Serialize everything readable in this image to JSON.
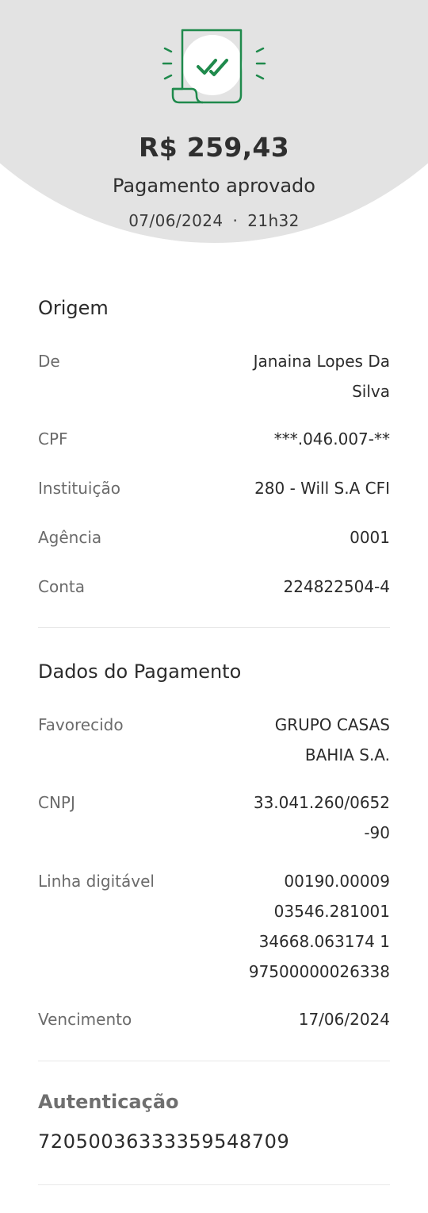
{
  "header": {
    "amount": "R$ 259,43",
    "status": "Pagamento aprovado",
    "date": "07/06/2024",
    "separator": "·",
    "time": "21h32",
    "icon": "receipt-check-icon",
    "accent_color": "#1f8a4c",
    "background_color": "#e3e3e3"
  },
  "origem": {
    "title": "Origem",
    "rows": [
      {
        "label": "De",
        "value_lines": [
          "Janaina Lopes Da",
          "Silva"
        ]
      },
      {
        "label": "CPF",
        "value_lines": [
          "***.046.007-**"
        ]
      },
      {
        "label": "Instituição",
        "value_lines": [
          "280 - Will S.A CFI"
        ]
      },
      {
        "label": "Agência",
        "value_lines": [
          "0001"
        ]
      },
      {
        "label": "Conta",
        "value_lines": [
          "224822504-4"
        ]
      }
    ]
  },
  "pagamento": {
    "title": "Dados do Pagamento",
    "rows": [
      {
        "label": "Favorecido",
        "value_lines": [
          "GRUPO CASAS",
          "BAHIA S.A."
        ]
      },
      {
        "label": "CNPJ",
        "value_lines": [
          "33.041.260/0652",
          "-90"
        ]
      },
      {
        "label": "Linha digitável",
        "value_lines": [
          "00190.00009",
          "03546.281001",
          "34668.063174 1",
          "97500000026338"
        ]
      },
      {
        "label": "Vencimento",
        "value_lines": [
          "17/06/2024"
        ]
      }
    ]
  },
  "autenticacao": {
    "title": "Autenticação",
    "value": "72050036333359548709"
  }
}
